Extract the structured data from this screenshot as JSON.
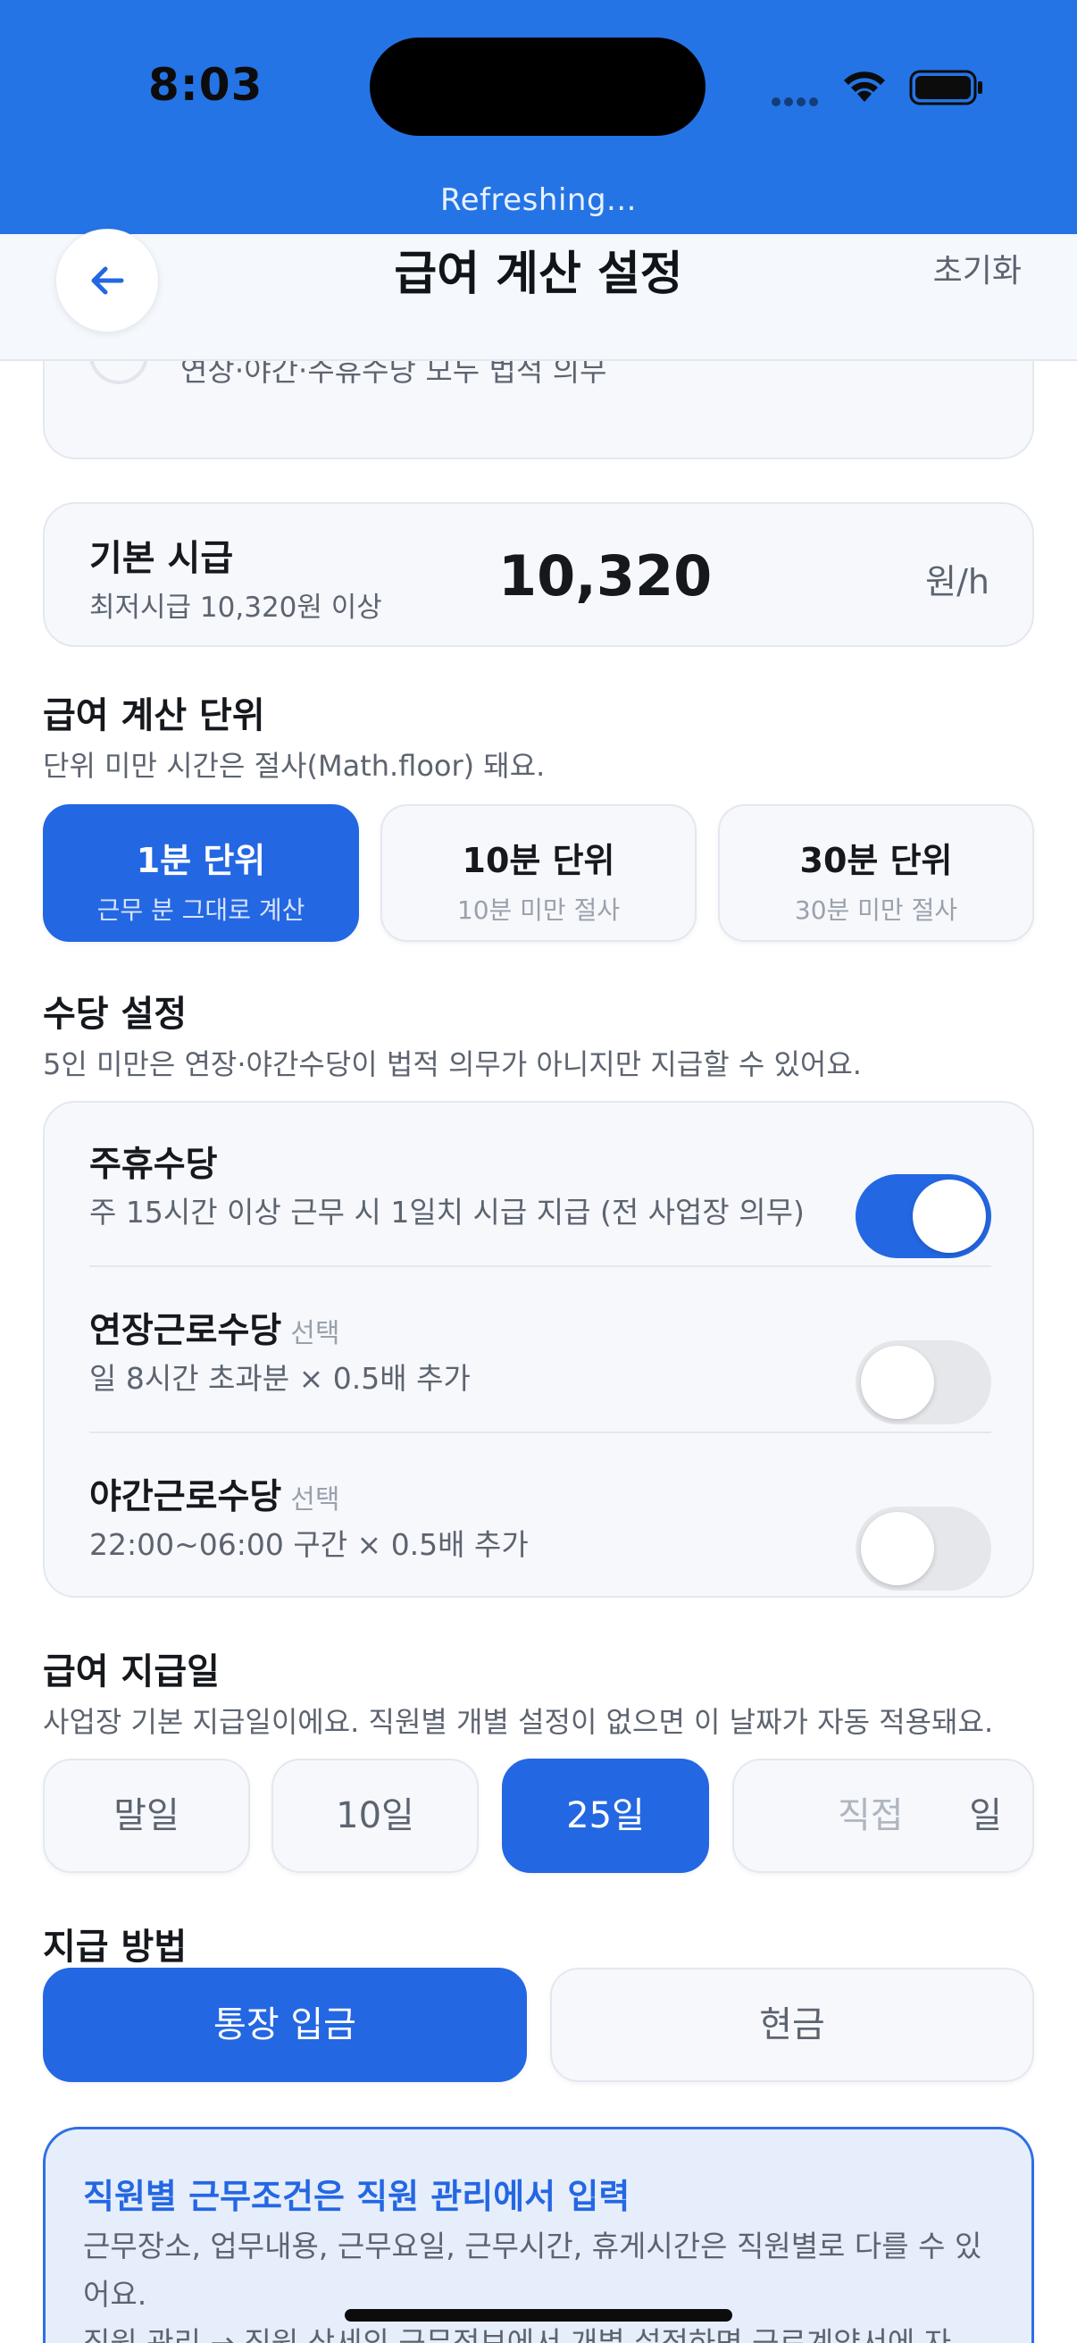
{
  "status_bar": {
    "time": "8:03",
    "refreshing": "Refreshing..."
  },
  "header": {
    "title": "급여 계산 설정",
    "reset_label": "초기화",
    "back_icon": "arrow-left-icon"
  },
  "partial_option": {
    "description": "연장·야간·주휴수당 모두 법적 의무"
  },
  "base_wage": {
    "label": "기본 시급",
    "hint": "최저시급 10,320원 이상",
    "value": "10,320",
    "unit": "원/h"
  },
  "calc_unit": {
    "title": "급여 계산 단위",
    "description": "단위 미만 시간은 절사(Math.floor) 돼요.",
    "options": [
      {
        "label": "1분 단위",
        "sub": "근무 분 그대로 계산",
        "selected": true
      },
      {
        "label": "10분 단위",
        "sub": "10분 미만 절사",
        "selected": false
      },
      {
        "label": "30분 단위",
        "sub": "30분 미만 절사",
        "selected": false
      }
    ]
  },
  "allowances": {
    "title": "수당 설정",
    "description": "5인 미만은 연장·야간수당이 법적 의무가 아니지만 지급할 수 있어요.",
    "items": [
      {
        "name": "주휴수당",
        "tag": "",
        "desc": "주 15시간 이상 근무 시 1일치 시급 지급 (전 사업장 의무)",
        "enabled": true
      },
      {
        "name": "연장근로수당",
        "tag": "선택",
        "desc": "일 8시간 초과분 × 0.5배 추가",
        "enabled": false
      },
      {
        "name": "야간근로수당",
        "tag": "선택",
        "desc": "22:00~06:00 구간 × 0.5배 추가",
        "enabled": false
      }
    ]
  },
  "payday": {
    "title": "급여 지급일",
    "description": "사업장 기본 지급일이에요. 직원별 개별 설정이 없으면 이 날짜가 자동 적용돼요.",
    "options": [
      {
        "label": "말일",
        "selected": false
      },
      {
        "label": "10일",
        "selected": false
      },
      {
        "label": "25일",
        "selected": true
      }
    ],
    "direct_placeholder": "직접",
    "direct_suffix": "일"
  },
  "pay_method": {
    "title": "지급 방법",
    "options": [
      {
        "label": "통장 입금",
        "selected": true
      },
      {
        "label": "현금",
        "selected": false
      }
    ]
  },
  "info": {
    "title": "직원별 근무조건은 직원 관리에서 입력",
    "body": "근무장소, 업무내용, 근무요일, 근무시간, 휴게시간은 직원별로 다를 수 있어요.",
    "body2": "직원 관리 → 직원 상세의 근무정보에서 개별 설정하면 근로계약서에 자"
  },
  "colors": {
    "primary": "#2467e3",
    "status_bar": "#2474e5",
    "card_bg": "#f6f8fc",
    "info_bg": "#e6eefb"
  }
}
